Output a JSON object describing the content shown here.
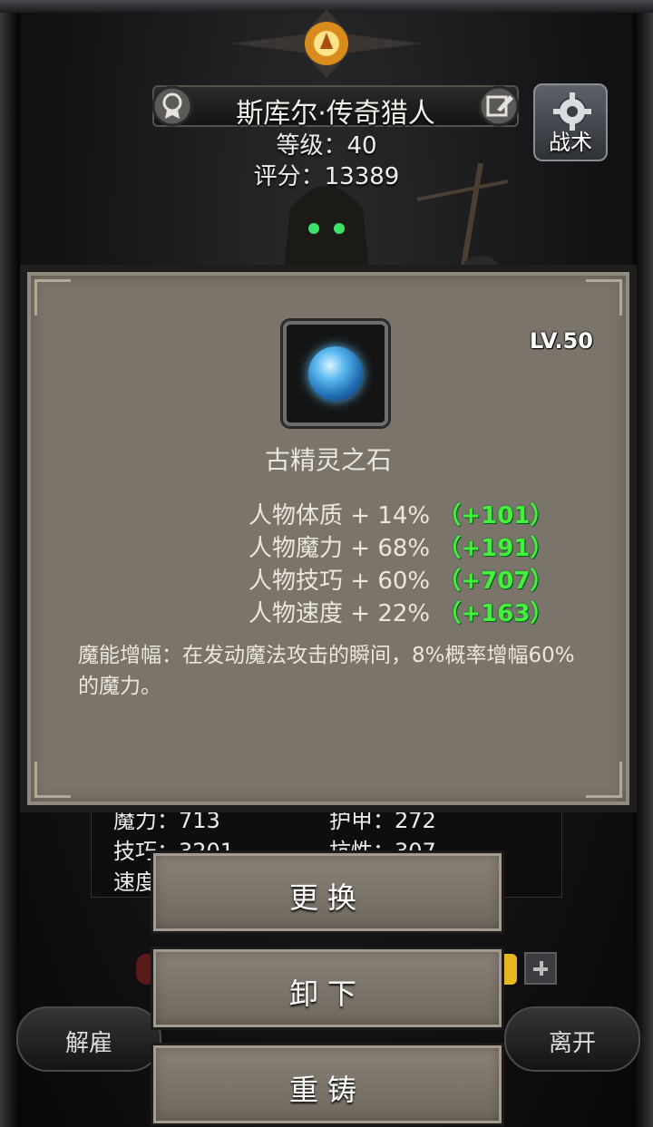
{
  "hero": {
    "name": "斯库尔·传奇猎人",
    "level_text": "等级：40",
    "score_text": "评分：13389"
  },
  "tactics": {
    "label": "战术"
  },
  "item": {
    "level": "LV.50",
    "name": "古精灵之石",
    "attributes": [
      {
        "text": "人物体质 + 14%",
        "bonus": "（+101）"
      },
      {
        "text": "人物魔力 + 68%",
        "bonus": "（+191）"
      },
      {
        "text": "人物技巧 + 60%",
        "bonus": "（+707）"
      },
      {
        "text": "人物速度 + 22%",
        "bonus": "（+163）"
      }
    ],
    "effect": "魔能增幅：在发动魔法攻击的瞬间，8%概率增幅60%的魔力。"
  },
  "stats": {
    "magic": "魔力：713",
    "armor": "护甲：272",
    "skill_partial": "技巧：3201",
    "resist_partial": "抗性：307",
    "speed_partial": "速度"
  },
  "actions": {
    "replace": "更换",
    "unequip": "卸下",
    "reforge": "重铸"
  },
  "bottom": {
    "dismiss": "解雇",
    "leave": "离开"
  },
  "colors": {
    "popup_bg": "#7b746a",
    "bonus_green": "#46ef3a"
  }
}
